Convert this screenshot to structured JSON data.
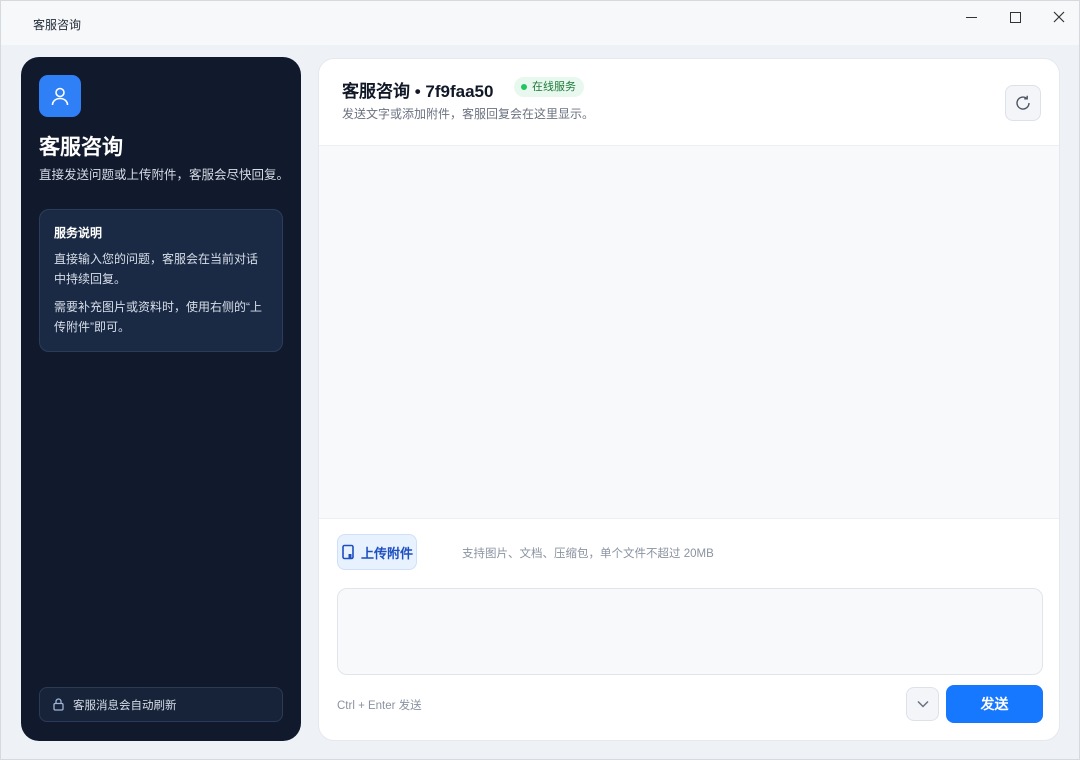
{
  "window": {
    "title": "客服咨询"
  },
  "sidebar": {
    "title": "客服咨询",
    "subtitle": "直接发送问题或上传附件，客服会尽快回复。",
    "card": {
      "heading": "服务说明",
      "p1": "直接输入您的问题，客服会在当前对话中持续回复。",
      "p2": "需要补充图片或资料时，使用右侧的“上传附件”即可。"
    },
    "footer": "客服消息会自动刷新"
  },
  "main": {
    "title": "客服咨询 • 7f9faa50",
    "status": "在线服务",
    "subtitle": "发送文字或添加附件，客服回复会在这里显示。",
    "attach_label": "上传附件",
    "attach_hint": "支持图片、文档、压缩包，单个文件不超过 20MB",
    "input_value": "",
    "shortcut_hint": "Ctrl + Enter 发送",
    "send_label": "发送"
  },
  "colors": {
    "accent": "#1677ff",
    "sidebar_bg": "#111a2c",
    "online": "#22c55e"
  },
  "icons": [
    "user-icon",
    "lock-icon",
    "refresh-icon",
    "paperclip-icon",
    "chevron-down-icon",
    "minimize-icon",
    "maximize-icon",
    "close-icon"
  ]
}
